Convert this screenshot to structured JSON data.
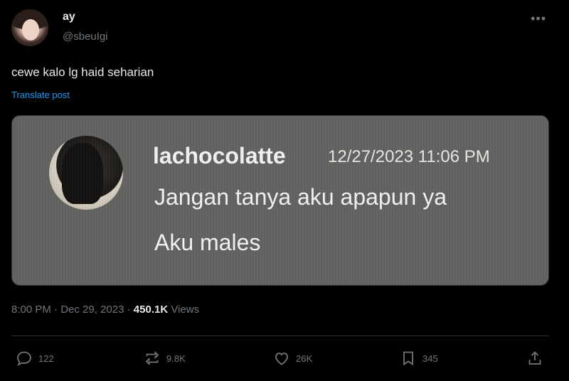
{
  "author": {
    "display_name": "ay",
    "handle": "@sbeuIgi"
  },
  "more_label": "•••",
  "tweet": {
    "text": "cewe kalo lg haid seharian",
    "translate_label": "Translate post"
  },
  "media": {
    "username": "lachocolatte",
    "timestamp": "12/27/2023 11:06 PM",
    "line1": "Jangan tanya aku apapun ya",
    "line2": "Aku males"
  },
  "meta": {
    "time": "8:00 PM",
    "sep1": " · ",
    "date": "Dec 29, 2023",
    "sep2": " · ",
    "views_count": "450.1K",
    "views_label": " Views"
  },
  "actions": {
    "replies": "122",
    "reposts": "9.8K",
    "likes": "26K",
    "bookmarks": "345"
  },
  "icons": {
    "reply": "reply-icon",
    "repost": "repost-icon",
    "like": "heart-icon",
    "bookmark": "bookmark-icon",
    "share": "share-icon"
  },
  "colors": {
    "background": "#000000",
    "text": "#e7e9ea",
    "muted": "#71767b",
    "link": "#1d9bf0",
    "media_bg": "#626260"
  }
}
